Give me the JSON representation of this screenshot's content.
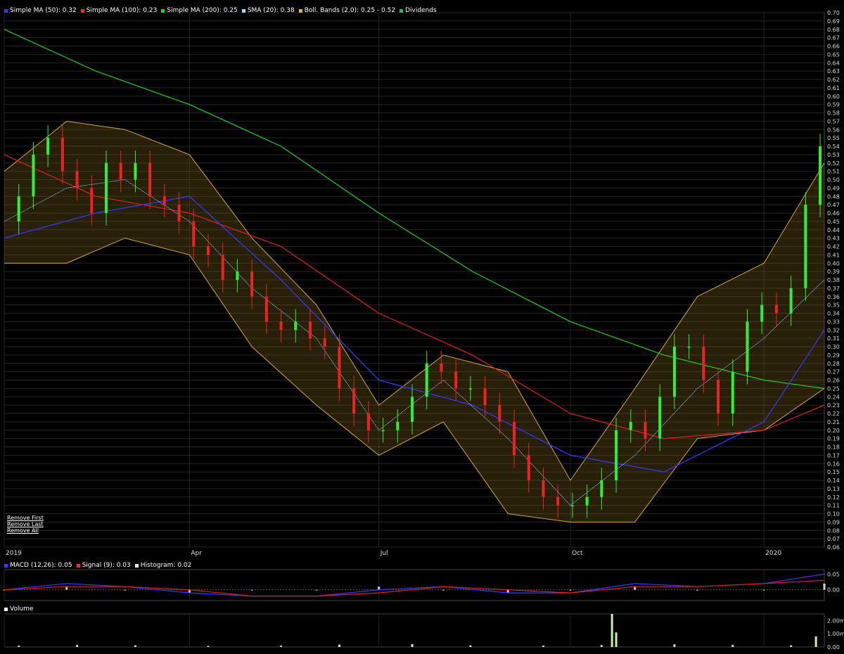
{
  "legend_main": [
    {
      "label": "Simple MA (50): 0.32",
      "color": "#3a3aff"
    },
    {
      "label": "Simple MA (100): 0.23",
      "color": "#ff2a2a"
    },
    {
      "label": "Simple MA (200): 0.25",
      "color": "#22cc22"
    },
    {
      "label": "SMA (20): 0.38",
      "color": "#9fd8ff"
    },
    {
      "label": "Boll. Bands (2.0): 0.25 - 0.52",
      "color": "#e0b040"
    },
    {
      "label": "Dividends",
      "color": "#33aa66"
    }
  ],
  "legend_macd": [
    {
      "label": "MACD (12,26): 0.05",
      "color": "#3a3aff"
    },
    {
      "label": "Signal (9): 0.03",
      "color": "#ff2a2a"
    },
    {
      "label": "Histogram: 0.02",
      "color": "#ffffff"
    }
  ],
  "legend_volume": [
    {
      "label": "Volume",
      "color": "#ffffff"
    }
  ],
  "remove_links": {
    "first": "Remove First",
    "last": "Remove Last",
    "all": "Remove All"
  },
  "chart_data": [
    {
      "type": "candlestick",
      "title": "",
      "x_labels": [
        {
          "label": "2019",
          "date": "2019-01-02"
        },
        {
          "label": "Apr",
          "date": "2019-04-01"
        },
        {
          "label": "Jul",
          "date": "2019-07-01"
        },
        {
          "label": "Oct",
          "date": "2019-10-01"
        },
        {
          "label": "2020",
          "date": "2020-01-02"
        }
      ],
      "xlim": [
        "2019-01-02",
        "2020-01-31"
      ],
      "ylim": [
        0.06,
        0.7
      ],
      "y_ticks": [
        "0.06",
        "0.07",
        "0.08",
        "0.09",
        "0.10",
        "0.11",
        "0.12",
        "0.13",
        "0.14",
        "0.15",
        "0.16",
        "0.17",
        "0.18",
        "0.19",
        "0.20",
        "0.21",
        "0.22",
        "0.23",
        "0.24",
        "0.25",
        "0.26",
        "0.27",
        "0.28",
        "0.29",
        "0.30",
        "0.31",
        "0.32",
        "0.33",
        "0.34",
        "0.35",
        "0.36",
        "0.37",
        "0.38",
        "0.39",
        "0.40",
        "0.41",
        "0.42",
        "0.43",
        "0.44",
        "0.45",
        "0.46",
        "0.47",
        "0.48",
        "0.49",
        "0.50",
        "0.51",
        "0.52",
        "0.53",
        "0.54",
        "0.55",
        "0.56",
        "0.57",
        "0.58",
        "0.59",
        "0.60",
        "0.61",
        "0.62",
        "0.63",
        "0.64",
        "0.65",
        "0.66",
        "0.67",
        "0.68",
        "0.69",
        "0.70"
      ],
      "grid": true,
      "price_series": [
        {
          "date": "2019-01-02",
          "close": 0.45
        },
        {
          "date": "2019-01-09",
          "close": 0.48
        },
        {
          "date": "2019-01-16",
          "close": 0.53
        },
        {
          "date": "2019-01-23",
          "close": 0.55
        },
        {
          "date": "2019-01-30",
          "close": 0.51
        },
        {
          "date": "2019-02-06",
          "close": 0.49
        },
        {
          "date": "2019-02-13",
          "close": 0.46
        },
        {
          "date": "2019-02-20",
          "close": 0.52
        },
        {
          "date": "2019-02-27",
          "close": 0.5
        },
        {
          "date": "2019-03-06",
          "close": 0.52
        },
        {
          "date": "2019-03-13",
          "close": 0.48
        },
        {
          "date": "2019-03-20",
          "close": 0.47
        },
        {
          "date": "2019-03-27",
          "close": 0.45
        },
        {
          "date": "2019-04-03",
          "close": 0.42
        },
        {
          "date": "2019-04-10",
          "close": 0.41
        },
        {
          "date": "2019-04-17",
          "close": 0.38
        },
        {
          "date": "2019-04-24",
          "close": 0.39
        },
        {
          "date": "2019-05-01",
          "close": 0.36
        },
        {
          "date": "2019-05-08",
          "close": 0.33
        },
        {
          "date": "2019-05-15",
          "close": 0.32
        },
        {
          "date": "2019-05-22",
          "close": 0.33
        },
        {
          "date": "2019-05-29",
          "close": 0.31
        },
        {
          "date": "2019-06-05",
          "close": 0.3
        },
        {
          "date": "2019-06-12",
          "close": 0.25
        },
        {
          "date": "2019-06-19",
          "close": 0.22
        },
        {
          "date": "2019-06-26",
          "close": 0.2
        },
        {
          "date": "2019-07-03",
          "close": 0.2
        },
        {
          "date": "2019-07-10",
          "close": 0.21
        },
        {
          "date": "2019-07-17",
          "close": 0.24
        },
        {
          "date": "2019-07-24",
          "close": 0.28
        },
        {
          "date": "2019-07-31",
          "close": 0.27
        },
        {
          "date": "2019-08-07",
          "close": 0.25
        },
        {
          "date": "2019-08-14",
          "close": 0.25
        },
        {
          "date": "2019-08-21",
          "close": 0.23
        },
        {
          "date": "2019-08-28",
          "close": 0.21
        },
        {
          "date": "2019-09-04",
          "close": 0.17
        },
        {
          "date": "2019-09-11",
          "close": 0.14
        },
        {
          "date": "2019-09-18",
          "close": 0.12
        },
        {
          "date": "2019-09-25",
          "close": 0.11
        },
        {
          "date": "2019-10-02",
          "close": 0.11
        },
        {
          "date": "2019-10-09",
          "close": 0.12
        },
        {
          "date": "2019-10-16",
          "close": 0.14
        },
        {
          "date": "2019-10-23",
          "close": 0.2
        },
        {
          "date": "2019-10-30",
          "close": 0.21
        },
        {
          "date": "2019-11-06",
          "close": 0.19
        },
        {
          "date": "2019-11-13",
          "close": 0.24
        },
        {
          "date": "2019-11-20",
          "close": 0.3
        },
        {
          "date": "2019-11-27",
          "close": 0.3
        },
        {
          "date": "2019-12-04",
          "close": 0.26
        },
        {
          "date": "2019-12-11",
          "close": 0.22
        },
        {
          "date": "2019-12-18",
          "close": 0.27
        },
        {
          "date": "2019-12-25",
          "close": 0.33
        },
        {
          "date": "2020-01-01",
          "close": 0.35
        },
        {
          "date": "2020-01-08",
          "close": 0.34
        },
        {
          "date": "2020-01-15",
          "close": 0.37
        },
        {
          "date": "2020-01-22",
          "close": 0.47
        },
        {
          "date": "2020-01-29",
          "close": 0.54
        }
      ],
      "sma_200": [
        {
          "date": "2019-01-02",
          "value": 0.68
        },
        {
          "date": "2019-02-15",
          "value": 0.63
        },
        {
          "date": "2019-04-01",
          "value": 0.59
        },
        {
          "date": "2019-05-15",
          "value": 0.54
        },
        {
          "date": "2019-07-01",
          "value": 0.46
        },
        {
          "date": "2019-08-15",
          "value": 0.39
        },
        {
          "date": "2019-10-01",
          "value": 0.33
        },
        {
          "date": "2019-11-15",
          "value": 0.29
        },
        {
          "date": "2020-01-02",
          "value": 0.26
        },
        {
          "date": "2020-01-31",
          "value": 0.25
        }
      ],
      "sma_100": [
        {
          "date": "2019-01-02",
          "value": 0.53
        },
        {
          "date": "2019-02-15",
          "value": 0.48
        },
        {
          "date": "2019-04-01",
          "value": 0.46
        },
        {
          "date": "2019-05-15",
          "value": 0.42
        },
        {
          "date": "2019-07-01",
          "value": 0.34
        },
        {
          "date": "2019-08-15",
          "value": 0.29
        },
        {
          "date": "2019-10-01",
          "value": 0.22
        },
        {
          "date": "2019-11-15",
          "value": 0.19
        },
        {
          "date": "2020-01-02",
          "value": 0.2
        },
        {
          "date": "2020-01-31",
          "value": 0.23
        }
      ],
      "sma_50": [
        {
          "date": "2019-01-02",
          "value": 0.43
        },
        {
          "date": "2019-02-15",
          "value": 0.46
        },
        {
          "date": "2019-04-01",
          "value": 0.48
        },
        {
          "date": "2019-05-15",
          "value": 0.38
        },
        {
          "date": "2019-07-01",
          "value": 0.26
        },
        {
          "date": "2019-08-15",
          "value": 0.23
        },
        {
          "date": "2019-10-01",
          "value": 0.17
        },
        {
          "date": "2019-11-15",
          "value": 0.15
        },
        {
          "date": "2020-01-02",
          "value": 0.21
        },
        {
          "date": "2020-01-31",
          "value": 0.32
        }
      ],
      "sma_20": [
        {
          "date": "2019-01-02",
          "value": 0.45
        },
        {
          "date": "2019-02-01",
          "value": 0.49
        },
        {
          "date": "2019-03-01",
          "value": 0.5
        },
        {
          "date": "2019-04-01",
          "value": 0.45
        },
        {
          "date": "2019-05-01",
          "value": 0.37
        },
        {
          "date": "2019-06-01",
          "value": 0.31
        },
        {
          "date": "2019-07-01",
          "value": 0.2
        },
        {
          "date": "2019-08-01",
          "value": 0.26
        },
        {
          "date": "2019-09-01",
          "value": 0.19
        },
        {
          "date": "2019-10-01",
          "value": 0.11
        },
        {
          "date": "2019-11-01",
          "value": 0.17
        },
        {
          "date": "2019-12-01",
          "value": 0.25
        },
        {
          "date": "2020-01-02",
          "value": 0.31
        },
        {
          "date": "2020-01-31",
          "value": 0.38
        }
      ],
      "bollinger_upper": [
        {
          "date": "2019-01-02",
          "value": 0.51
        },
        {
          "date": "2019-02-01",
          "value": 0.57
        },
        {
          "date": "2019-03-01",
          "value": 0.56
        },
        {
          "date": "2019-04-01",
          "value": 0.53
        },
        {
          "date": "2019-05-01",
          "value": 0.43
        },
        {
          "date": "2019-06-01",
          "value": 0.35
        },
        {
          "date": "2019-07-01",
          "value": 0.23
        },
        {
          "date": "2019-08-01",
          "value": 0.29
        },
        {
          "date": "2019-09-01",
          "value": 0.27
        },
        {
          "date": "2019-10-01",
          "value": 0.14
        },
        {
          "date": "2019-11-01",
          "value": 0.25
        },
        {
          "date": "2019-12-01",
          "value": 0.36
        },
        {
          "date": "2020-01-02",
          "value": 0.4
        },
        {
          "date": "2020-01-31",
          "value": 0.52
        }
      ],
      "bollinger_lower": [
        {
          "date": "2019-01-02",
          "value": 0.4
        },
        {
          "date": "2019-02-01",
          "value": 0.4
        },
        {
          "date": "2019-03-01",
          "value": 0.43
        },
        {
          "date": "2019-04-01",
          "value": 0.41
        },
        {
          "date": "2019-05-01",
          "value": 0.3
        },
        {
          "date": "2019-06-01",
          "value": 0.23
        },
        {
          "date": "2019-07-01",
          "value": 0.17
        },
        {
          "date": "2019-08-01",
          "value": 0.21
        },
        {
          "date": "2019-09-01",
          "value": 0.1
        },
        {
          "date": "2019-10-01",
          "value": 0.09
        },
        {
          "date": "2019-11-01",
          "value": 0.09
        },
        {
          "date": "2019-12-01",
          "value": 0.19
        },
        {
          "date": "2020-01-02",
          "value": 0.2
        },
        {
          "date": "2020-01-31",
          "value": 0.25
        }
      ]
    },
    {
      "type": "line",
      "title": "",
      "y_ticks": [
        "0.05",
        "0.00"
      ],
      "ylim": [
        -0.03,
        0.06
      ],
      "series": [
        {
          "name": "MACD (12,26)",
          "values": [
            {
              "date": "2019-01-02",
              "value": 0.0
            },
            {
              "date": "2019-02-01",
              "value": 0.02
            },
            {
              "date": "2019-03-01",
              "value": 0.01
            },
            {
              "date": "2019-04-01",
              "value": -0.01
            },
            {
              "date": "2019-05-01",
              "value": -0.02
            },
            {
              "date": "2019-06-01",
              "value": -0.02
            },
            {
              "date": "2019-07-01",
              "value": 0.0
            },
            {
              "date": "2019-08-01",
              "value": 0.01
            },
            {
              "date": "2019-09-01",
              "value": -0.01
            },
            {
              "date": "2019-10-01",
              "value": -0.01
            },
            {
              "date": "2019-11-01",
              "value": 0.02
            },
            {
              "date": "2019-12-01",
              "value": 0.01
            },
            {
              "date": "2020-01-02",
              "value": 0.02
            },
            {
              "date": "2020-01-31",
              "value": 0.05
            }
          ]
        },
        {
          "name": "Signal (9)",
          "values": [
            {
              "date": "2019-01-02",
              "value": 0.0
            },
            {
              "date": "2019-02-01",
              "value": 0.01
            },
            {
              "date": "2019-03-01",
              "value": 0.01
            },
            {
              "date": "2019-04-01",
              "value": 0.0
            },
            {
              "date": "2019-05-01",
              "value": -0.02
            },
            {
              "date": "2019-06-01",
              "value": -0.02
            },
            {
              "date": "2019-07-01",
              "value": -0.01
            },
            {
              "date": "2019-08-01",
              "value": 0.01
            },
            {
              "date": "2019-09-01",
              "value": 0.0
            },
            {
              "date": "2019-10-01",
              "value": -0.01
            },
            {
              "date": "2019-11-01",
              "value": 0.01
            },
            {
              "date": "2019-12-01",
              "value": 0.01
            },
            {
              "date": "2020-01-02",
              "value": 0.02
            },
            {
              "date": "2020-01-31",
              "value": 0.03
            }
          ]
        }
      ]
    },
    {
      "type": "bar",
      "title": "",
      "y_ticks": [
        "2.00m",
        "1.00m",
        "0.00"
      ],
      "ylim": [
        0,
        2.5
      ],
      "note_units": "m",
      "bars": [
        {
          "date": "2019-01-09",
          "value": 0.1
        },
        {
          "date": "2019-02-06",
          "value": 0.15
        },
        {
          "date": "2019-03-06",
          "value": 0.12
        },
        {
          "date": "2019-04-10",
          "value": 0.08
        },
        {
          "date": "2019-05-15",
          "value": 0.1
        },
        {
          "date": "2019-06-12",
          "value": 0.18
        },
        {
          "date": "2019-07-17",
          "value": 0.22
        },
        {
          "date": "2019-08-14",
          "value": 0.12
        },
        {
          "date": "2019-09-18",
          "value": 0.1
        },
        {
          "date": "2019-10-16",
          "value": 0.14
        },
        {
          "date": "2019-10-21",
          "value": 2.6
        },
        {
          "date": "2019-10-23",
          "value": 1.1
        },
        {
          "date": "2019-11-20",
          "value": 0.2
        },
        {
          "date": "2019-12-18",
          "value": 0.15
        },
        {
          "date": "2020-01-15",
          "value": 0.12
        },
        {
          "date": "2020-01-27",
          "value": 0.8
        }
      ]
    }
  ]
}
